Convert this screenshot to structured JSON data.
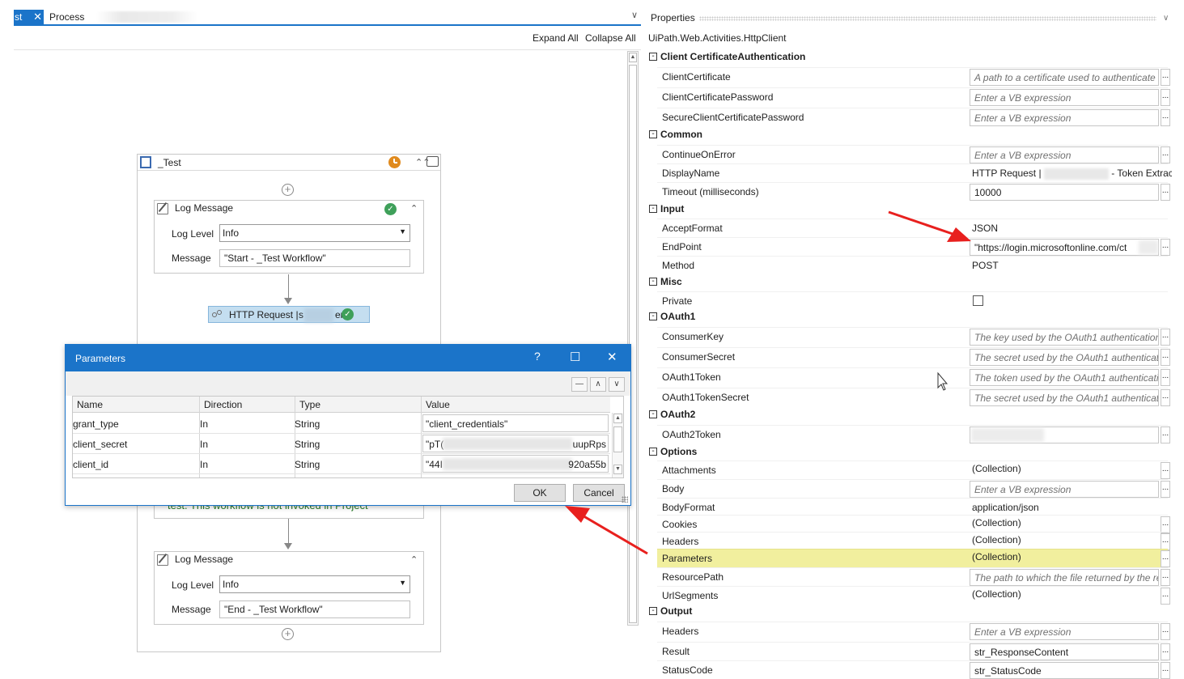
{
  "designer": {
    "tabs": [
      {
        "label": "st",
        "close": "✕"
      },
      {
        "label": "Process"
      }
    ],
    "expand_all": "Expand All",
    "collapse_all": "Collapse All",
    "sequence": {
      "title": "_Test",
      "log_start": {
        "title": "Log Message",
        "level_label": "Log Level",
        "level_value": "Info",
        "message_label": "Message",
        "message_value": "\"Start - _Test Workflow\""
      },
      "http": {
        "title": "HTTP Request |",
        "mid": "s",
        "tail": "er"
      },
      "partial_text": "test. This workflow is not invoked in Project",
      "log_end": {
        "title": "Log Message",
        "level_label": "Log Level",
        "level_value": "Info",
        "message_label": "Message",
        "message_value": "\"End - _Test Workflow\""
      }
    }
  },
  "properties": {
    "title": "Properties",
    "type_name": "UiPath.Web.Activities.HttpClient",
    "categories": {
      "cert": "Client CertificateAuthentication",
      "common": "Common",
      "input": "Input",
      "misc": "Misc",
      "oauth1": "OAuth1",
      "oauth2": "OAuth2",
      "options": "Options",
      "output": "Output"
    },
    "rows": {
      "client_certificate": {
        "name": "ClientCertificate",
        "value": "A path to a certificate used to authenticate"
      },
      "client_certificate_password": {
        "name": "ClientCertificatePassword",
        "value": "Enter a VB expression"
      },
      "secure_client_certificate_password": {
        "name": "SecureClientCertificatePassword",
        "value": "Enter a VB expression"
      },
      "continue_on_error": {
        "name": "ContinueOnError",
        "value": "Enter a VB expression"
      },
      "display_name": {
        "name": "DisplayName",
        "value_start": "HTTP Request |",
        "value_end": "- Token Extract"
      },
      "timeout": {
        "name": "Timeout (milliseconds)",
        "value": "10000"
      },
      "accept_format": {
        "name": "AcceptFormat",
        "value": "JSON"
      },
      "endpoint": {
        "name": "EndPoint",
        "value": "\"https://login.microsoftonline.com/ct"
      },
      "method": {
        "name": "Method",
        "value": "POST"
      },
      "private": {
        "name": "Private",
        "checked": false
      },
      "consumer_key": {
        "name": "ConsumerKey",
        "value": "The key used by the OAuth1 authentication"
      },
      "consumer_secret": {
        "name": "ConsumerSecret",
        "value": "The secret used by the OAuth1 authenticati"
      },
      "oauth1_token": {
        "name": "OAuth1Token",
        "value": "The token used by the OAuth1 authenticatio"
      },
      "oauth1_token_secret": {
        "name": "OAuth1TokenSecret",
        "value": "The secret used by the OAuth1 authenticati"
      },
      "oauth2_token": {
        "name": "OAuth2Token",
        "value": ""
      },
      "attachments": {
        "name": "Attachments",
        "value": "(Collection)"
      },
      "body": {
        "name": "Body",
        "value": "Enter a VB expression"
      },
      "body_format": {
        "name": "BodyFormat",
        "value": "application/json"
      },
      "cookies": {
        "name": "Cookies",
        "value": "(Collection)"
      },
      "headers": {
        "name": "Headers",
        "value": "(Collection)"
      },
      "parameters": {
        "name": "Parameters",
        "value": "(Collection)"
      },
      "resource_path": {
        "name": "ResourcePath",
        "value": "The path to which the file returned by the re"
      },
      "url_segments": {
        "name": "UrlSegments",
        "value": "(Collection)"
      },
      "out_headers": {
        "name": "Headers",
        "value": "Enter a VB expression"
      },
      "result": {
        "name": "Result",
        "value": "str_ResponseContent"
      },
      "status_code": {
        "name": "StatusCode",
        "value": "str_StatusCode"
      }
    },
    "ellipsis": "..."
  },
  "dialog": {
    "title": "Parameters",
    "help": "?",
    "maximize": "☐",
    "close": "✕",
    "toolbar": {
      "remove": "—",
      "up": "∧",
      "down": "∨"
    },
    "columns": [
      "Name",
      "Direction",
      "Type",
      "Value"
    ],
    "rows": [
      {
        "name": "grant_type",
        "direction": "In",
        "type": "String",
        "value_start": "\"client_credentials\"",
        "value_end": ""
      },
      {
        "name": "client_secret",
        "direction": "In",
        "type": "String",
        "value_start": "\"pT(",
        "value_end": "uupRps"
      },
      {
        "name": "client_id",
        "direction": "In",
        "type": "String",
        "value_start": "\"44I",
        "value_end": "920a55b"
      }
    ],
    "ok": "OK",
    "cancel": "Cancel"
  },
  "colors": {
    "accent": "#1b74c9",
    "highlight": "#f1ef9e",
    "arrow": "#e8201e",
    "success": "#3fa05a",
    "timer": "#e08a1e"
  }
}
